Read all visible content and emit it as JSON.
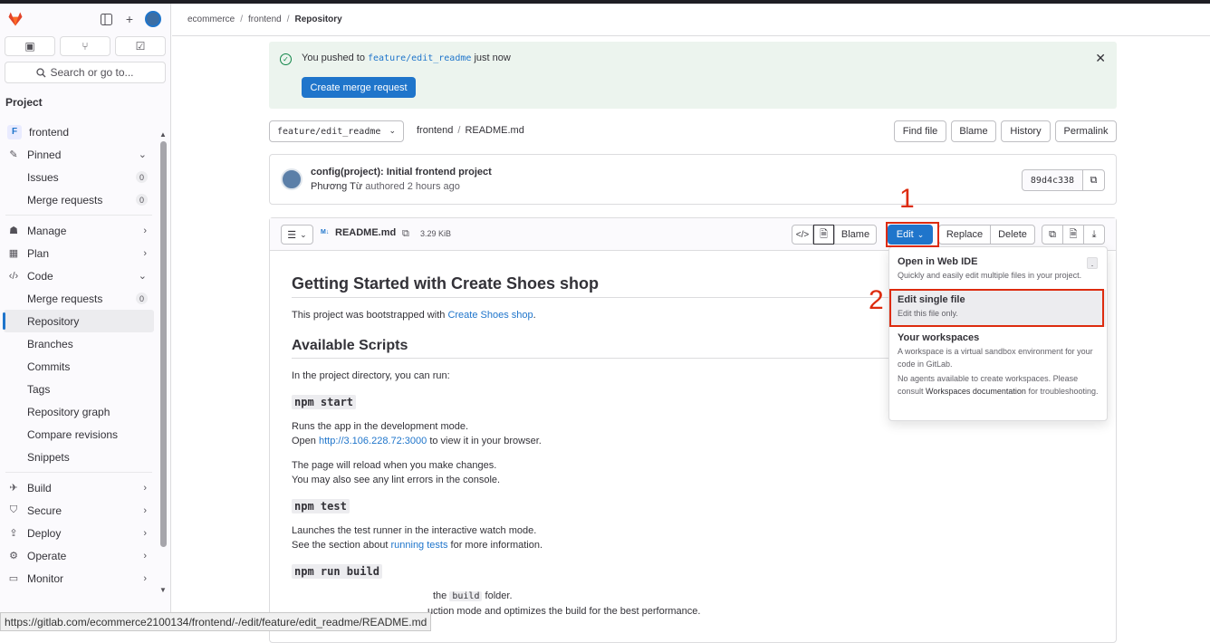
{
  "sidebar": {
    "search_label": "Search or go to...",
    "section_title": "Project",
    "project": {
      "badge": "F",
      "name": "frontend"
    },
    "items": [
      {
        "label": "Pinned",
        "chevron": "⌄",
        "icon": "pin-icon"
      },
      {
        "label": "Issues",
        "count": "0",
        "sub": true
      },
      {
        "label": "Merge requests",
        "count": "0",
        "sub": true
      },
      {
        "label": "Manage",
        "chevron": "›",
        "icon": "users-icon"
      },
      {
        "label": "Plan",
        "chevron": "›",
        "icon": "plan-icon"
      },
      {
        "label": "Code",
        "chevron": "⌄",
        "icon": "code-icon"
      },
      {
        "label": "Merge requests",
        "count": "0",
        "sub": true
      },
      {
        "label": "Repository",
        "sub": true,
        "active": true
      },
      {
        "label": "Branches",
        "sub": true
      },
      {
        "label": "Commits",
        "sub": true
      },
      {
        "label": "Tags",
        "sub": true
      },
      {
        "label": "Repository graph",
        "sub": true
      },
      {
        "label": "Compare revisions",
        "sub": true
      },
      {
        "label": "Snippets",
        "sub": true
      },
      {
        "label": "Build",
        "chevron": "›",
        "icon": "rocket-icon"
      },
      {
        "label": "Secure",
        "chevron": "›",
        "icon": "shield-icon"
      },
      {
        "label": "Deploy",
        "chevron": "›",
        "icon": "deploy-icon"
      },
      {
        "label": "Operate",
        "chevron": "›",
        "icon": "operate-icon"
      },
      {
        "label": "Monitor",
        "chevron": "›",
        "icon": "monitor-icon"
      }
    ]
  },
  "breadcrumb": [
    "ecommerce",
    "frontend",
    "Repository"
  ],
  "alert": {
    "text_before": "You pushed to",
    "branch": "feature/edit_readme",
    "text_after": "just now",
    "button": "Create merge request"
  },
  "path_bar": {
    "branch": "feature/edit_readme",
    "project": "frontend",
    "file": "README.md",
    "buttons": [
      "Find file",
      "Blame",
      "History",
      "Permalink"
    ]
  },
  "commit": {
    "title": "config(project): Initial frontend project",
    "author": "Phương Từ",
    "meta": "authored 2 hours ago",
    "sha": "89d4c338"
  },
  "file": {
    "md_label": "M↓",
    "name": "README.md",
    "size": "3.29 KiB",
    "blame": "Blame",
    "edit": "Edit",
    "replace": "Replace",
    "delete": "Delete"
  },
  "readme": {
    "h1": "Getting Started with Create Shoes shop",
    "intro_before": "This project was bootstrapped with",
    "intro_link": "Create Shoes shop",
    "intro_after": ".",
    "h2": "Available Scripts",
    "dir_text": "In the project directory, you can run:",
    "cmd1": "npm start",
    "start_line1": "Runs the app in the development mode.",
    "start_open": "Open",
    "start_link": "http://3.106.228.72:3000",
    "start_after": "to view it in your browser.",
    "reload1": "The page will reload when you make changes.",
    "reload2": "You may also see any lint errors in the console.",
    "cmd2": "npm test",
    "test1": "Launches the test runner in the interactive watch mode.",
    "test2_before": "See the section about",
    "test2_link": "running tests",
    "test2_after": "for more information.",
    "cmd3": "npm run build",
    "build_visible": "the",
    "build_code": "build",
    "build_after": "folder.",
    "build_line2": "uction mode and optimizes the build for the best performance."
  },
  "dropdown": {
    "webide_title": "Open in Web IDE",
    "webide_key": ".",
    "webide_desc": "Quickly and easily edit multiple files in your project.",
    "single_title": "Edit single file",
    "single_desc": "Edit this file only.",
    "ws_title": "Your workspaces",
    "ws_desc": "A workspace is a virtual sandbox environment for your code in GitLab.",
    "ws_none_before": "No agents available to create workspaces. Please consult",
    "ws_none_link": "Workspaces documentation",
    "ws_none_after": "for troubleshooting."
  },
  "annotations": {
    "one": "1",
    "two": "2"
  },
  "status_url": "https://gitlab.com/ecommerce2100134/frontend/-/edit/feature/edit_readme/README.md",
  "colors": {
    "accent": "#1f75cb",
    "annotation": "#dd2b0e",
    "success_bg": "#ecf4ee"
  }
}
